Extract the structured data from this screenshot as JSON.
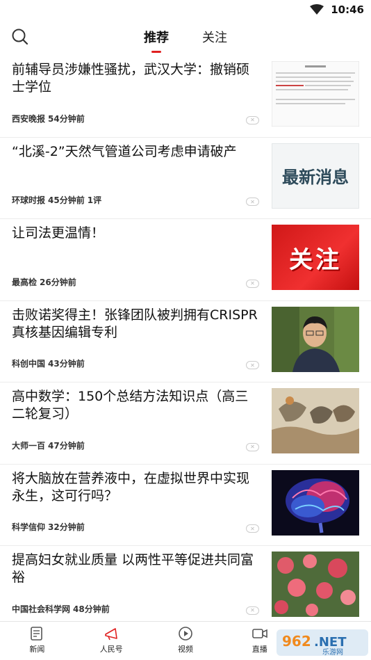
{
  "status": {
    "time": "10:46",
    "icons": [
      "wifi-icon"
    ]
  },
  "header": {
    "tabs": [
      {
        "label": "推荐",
        "active": true
      },
      {
        "label": "关注",
        "active": false
      }
    ]
  },
  "feed": [
    {
      "title": "前辅导员涉嫌性骚扰，武汉大学：撤销硕士学位",
      "source": "西安晚报",
      "time": "54分钟前",
      "comments": "",
      "thumb": "document"
    },
    {
      "title": "“北溪-2”天然气管道公司考虑申请破产",
      "source": "环球时报",
      "time": "45分钟前",
      "comments": "1评",
      "thumb": "latest-news"
    },
    {
      "title": "让司法更温情！",
      "source": "最高检",
      "time": "26分钟前",
      "comments": "",
      "thumb": "attention-banner"
    },
    {
      "title": "击败诺奖得主！张锋团队被判拥有CRISPR真核基因编辑专利",
      "source": "科创中国",
      "time": "43分钟前",
      "comments": "",
      "thumb": "portrait"
    },
    {
      "title": "高中数学：150个总结方法知识点（高三二轮复习）",
      "source": "大师一百",
      "time": "47分钟前",
      "comments": "",
      "thumb": "horses-painting"
    },
    {
      "title": "将大脑放在营养液中，在虚拟世界中实现永生，这可行吗？",
      "source": "科学信仰",
      "time": "32分钟前",
      "comments": "",
      "thumb": "brain"
    },
    {
      "title": "提高妇女就业质量 以两性平等促进共同富裕",
      "source": "中国社会科学网",
      "time": "48分钟前",
      "comments": "",
      "thumb": "roses"
    }
  ],
  "thumb_text": {
    "latest": "最新消息",
    "attention": "关注"
  },
  "bottom_nav": [
    {
      "label": "新闻",
      "icon": "news-icon"
    },
    {
      "label": "人民号",
      "icon": "megaphone-icon"
    },
    {
      "label": "视频",
      "icon": "play-icon"
    },
    {
      "label": "直播",
      "icon": "live-camera-icon"
    }
  ],
  "watermark": {
    "text": "962.NET",
    "subtitle": "乐游网"
  },
  "colors": {
    "accent": "#e02020",
    "divider": "#ececec"
  }
}
